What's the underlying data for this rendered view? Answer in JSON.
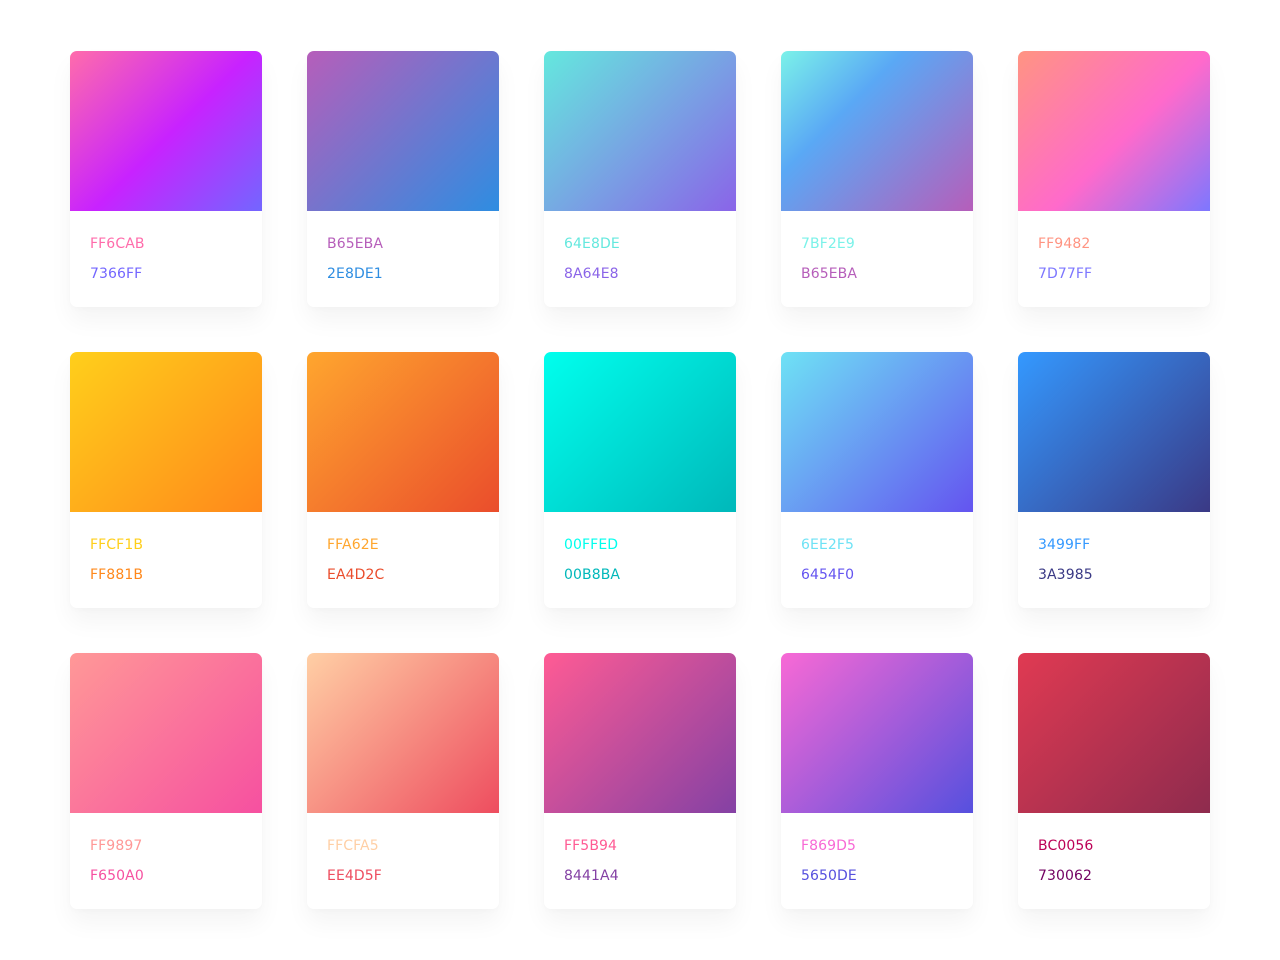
{
  "gradients": [
    {
      "from": "FF6CAB",
      "to": "7366FF",
      "from_color": "#FF6CAB",
      "to_color": "#7366FF",
      "mid_color": "#C822FF",
      "mid_stop": 52
    },
    {
      "from": "B65EBA",
      "to": "2E8DE1",
      "from_color": "#B65EBA",
      "to_color": "#2E8DE1"
    },
    {
      "from": "64E8DE",
      "to": "8A64E8",
      "from_color": "#64E8DE",
      "to_color": "#8A64E8"
    },
    {
      "from": "7BF2E9",
      "to": "B65EBA",
      "from_color": "#7BF2E9",
      "to_color": "#B65EBA",
      "mid_color": "#5AA8F5",
      "mid_stop": 35
    },
    {
      "from": "FF9482",
      "to": "7D77FF",
      "from_color": "#FF9482",
      "to_color": "#7D77FF",
      "mid_color": "#FF6ACB",
      "mid_stop": 55
    },
    {
      "from": "FFCF1B",
      "to": "FF881B",
      "from_color": "#FFCF1B",
      "to_color": "#FF881B"
    },
    {
      "from": "FFA62E",
      "to": "EA4D2C",
      "from_color": "#FFA62E",
      "to_color": "#EA4D2C"
    },
    {
      "from": "00FFED",
      "to": "00B8BA",
      "from_color": "#00FFED",
      "to_color": "#00B8BA"
    },
    {
      "from": "6EE2F5",
      "to": "6454F0",
      "from_color": "#6EE2F5",
      "to_color": "#6454F0"
    },
    {
      "from": "3499FF",
      "to": "3A3985",
      "from_color": "#3499FF",
      "to_color": "#3A3985"
    },
    {
      "from": "FF9897",
      "to": "F650A0",
      "from_color": "#FF9897",
      "to_color": "#F650A0"
    },
    {
      "from": "FFCFA5",
      "to": "EE4D5F",
      "from_color": "#FFCFA5",
      "to_color": "#EE4D5F"
    },
    {
      "from": "FF5B94",
      "to": "8441A4",
      "from_color": "#FF5B94",
      "to_color": "#8441A4"
    },
    {
      "from": "F869D5",
      "to": "5650DE",
      "from_color": "#F869D5",
      "to_color": "#5650DE"
    },
    {
      "from": "BC0056",
      "to": "730062",
      "from_color": "#BC0056",
      "to_color": "#730062",
      "swatch_from": "#E03A52",
      "swatch_to": "#8E2B4E"
    }
  ]
}
